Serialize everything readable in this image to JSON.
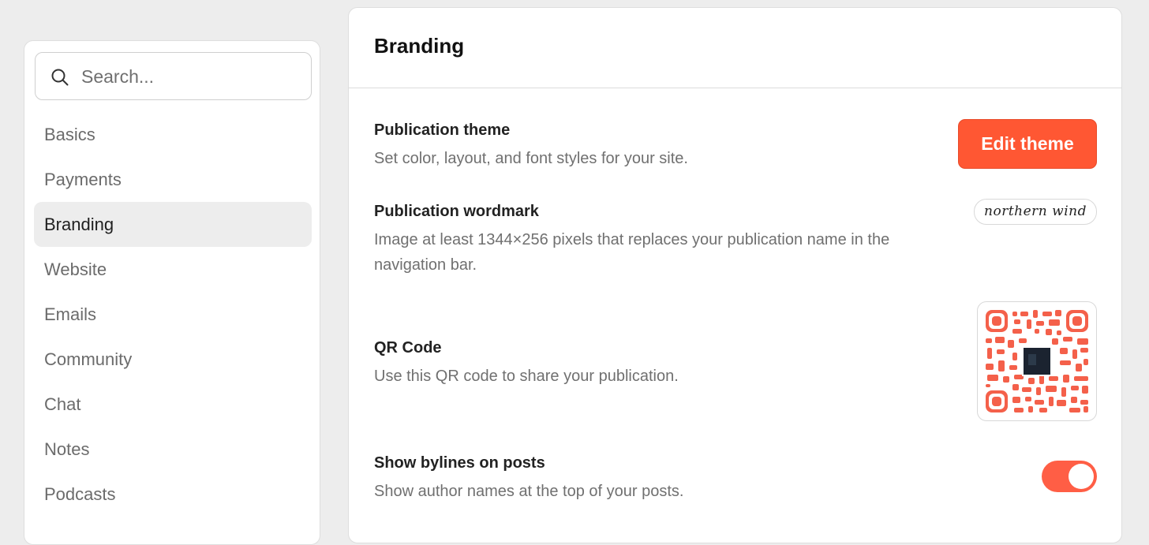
{
  "sidebar": {
    "search": {
      "placeholder": "Search..."
    },
    "items": [
      {
        "label": "Basics",
        "active": false
      },
      {
        "label": "Payments",
        "active": false
      },
      {
        "label": "Branding",
        "active": true
      },
      {
        "label": "Website",
        "active": false
      },
      {
        "label": "Emails",
        "active": false
      },
      {
        "label": "Community",
        "active": false
      },
      {
        "label": "Chat",
        "active": false
      },
      {
        "label": "Notes",
        "active": false
      },
      {
        "label": "Podcasts",
        "active": false
      }
    ]
  },
  "main": {
    "title": "Branding",
    "theme": {
      "title": "Publication theme",
      "description": "Set color, layout, and font styles for your site.",
      "button_label": "Edit theme"
    },
    "wordmark": {
      "title": "Publication wordmark",
      "description": "Image at least 1344×256 pixels that replaces your publication name in the navigation bar.",
      "image_text": "northern wind"
    },
    "qr": {
      "title": "QR Code",
      "description": "Use this QR code to share your publication.",
      "icon": "qr-code"
    },
    "bylines": {
      "title": "Show bylines on posts",
      "description": "Show author names at the top of your posts.",
      "enabled": true
    }
  },
  "colors": {
    "accent": "#ff5733",
    "toggle_on": "#ff5e45",
    "qr": "#f4604a",
    "active_nav_bg": "#ededed",
    "page_bg": "#ededed"
  }
}
